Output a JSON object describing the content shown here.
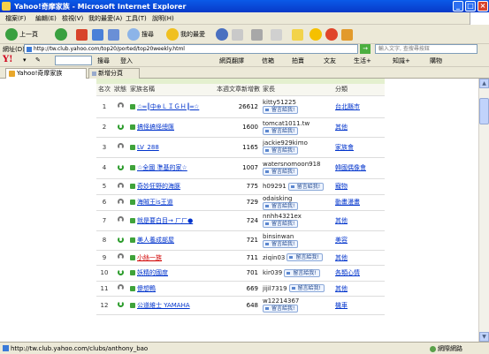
{
  "window": {
    "title": "Yahoo!奇摩家族 - Microsoft Internet Explorer"
  },
  "menu": [
    "檔案(F)",
    "編輯(E)",
    "檢視(V)",
    "我的最愛(A)",
    "工具(T)",
    "說明(H)"
  ],
  "toolbar": {
    "back_label": "上一頁",
    "search_label": "搜尋",
    "favorites_label": "我的最愛"
  },
  "address": {
    "label": "網址(D)",
    "url": "http://tw.club.yahoo.com/top20/ported/top20weekly.html",
    "search_placeholder": "輸入文字, 查搜尋按鈕"
  },
  "yahoo_toolbar": {
    "logo": "Y!",
    "search_btn": "搜尋",
    "login": "登入",
    "translate": "網頁翻譯",
    "mail": "信箱",
    "auction": "拍賣",
    "blog": "文友",
    "life": "生活+",
    "knowledge": "知識+",
    "shopping": "購物"
  },
  "tabs": {
    "active": "Yahoo!奇摩家族",
    "new_tab": "新增分頁"
  },
  "table": {
    "headers": [
      "名次",
      "狀態",
      "家族名稱",
      "本週文章新增數",
      "家長",
      "分類"
    ],
    "message_button": "留言給我!",
    "rows": [
      {
        "rank": "1",
        "status": "same",
        "name": "☆═║中⊕ＬＩＧＨ║═☆",
        "count": "26612",
        "owner": "kitty51225",
        "category": "台北縣市",
        "owner_layout": "stack"
      },
      {
        "rank": "2",
        "status": "up",
        "name": "搞怪搞怪總匯",
        "count": "1600",
        "owner": "tomcat1011.tw",
        "category": "其他",
        "owner_layout": "stack"
      },
      {
        "rank": "3",
        "status": "same",
        "name": "LV_288",
        "count": "1165",
        "owner": "jackie929kimo",
        "category": "家族會",
        "owner_layout": "stack"
      },
      {
        "rank": "4",
        "status": "up",
        "name": "☆全國 準基的家☆",
        "count": "1007",
        "owner": "watersnomoon918",
        "category": "韓國偶像會",
        "owner_layout": "stack"
      },
      {
        "rank": "5",
        "status": "same",
        "name": "奇妙狂野的海豚",
        "count": "775",
        "owner": "h09291",
        "category": "寵物",
        "owner_layout": "inline"
      },
      {
        "rank": "6",
        "status": "same",
        "name": "海賊王is王道",
        "count": "729",
        "owner": "odaisking",
        "category": "動畫漫畫",
        "owner_layout": "stack"
      },
      {
        "rank": "7",
        "status": "same",
        "name": "就是要白目→ ㄏㄏ●",
        "count": "724",
        "owner": "nnhh4321ex",
        "category": "其他",
        "owner_layout": "stack"
      },
      {
        "rank": "8",
        "status": "up",
        "name": "美人養成部屋",
        "count": "721",
        "owner": "binsinwan",
        "category": "美容",
        "owner_layout": "stack"
      },
      {
        "rank": "9",
        "status": "same",
        "name": "小絲一族",
        "count": "711",
        "owner": "ziqin03",
        "category": "其他",
        "owner_layout": "inline",
        "red": true
      },
      {
        "rank": "10",
        "status": "up",
        "name": "妖精的國度",
        "count": "701",
        "owner": "kir039",
        "category": "各類心情",
        "owner_layout": "inline"
      },
      {
        "rank": "11",
        "status": "same",
        "name": "傻想鴨",
        "count": "669",
        "owner": "jijil7319",
        "category": "其他",
        "owner_layout": "inline"
      },
      {
        "rank": "12",
        "status": "up",
        "name": "公道維士 YAMAHA",
        "count": "648",
        "owner": "w12214367",
        "category": "機車",
        "owner_layout": "stack"
      }
    ]
  },
  "status": {
    "text": "http://tw.club.yahoo.com/clubs/anthony_bao",
    "zone": "網際網路"
  }
}
